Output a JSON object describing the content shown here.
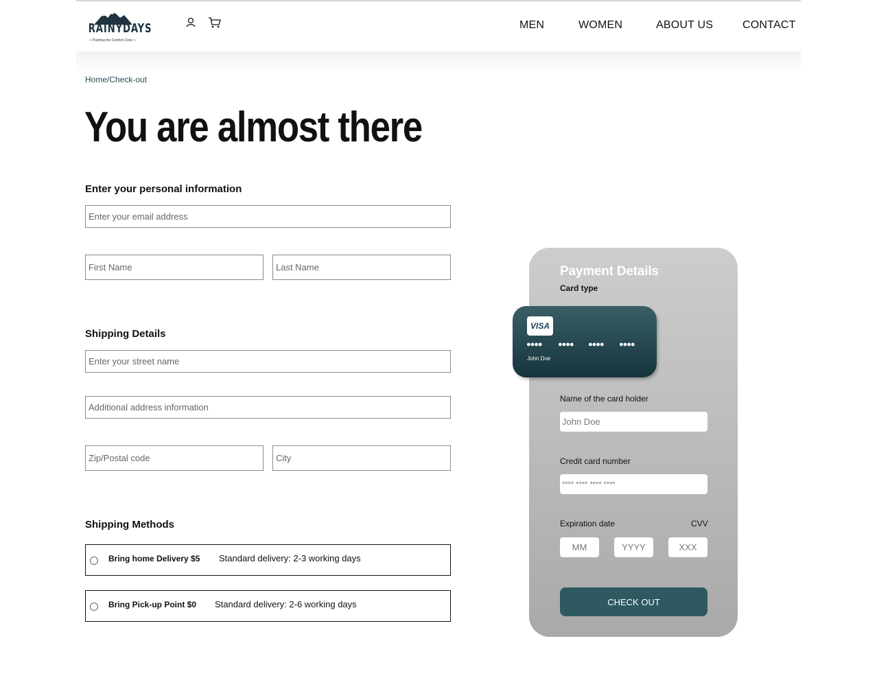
{
  "header": {
    "logo_text": "RAINYDAYS",
    "logo_tagline": "« Pushing the Comfort Zone »",
    "icons": {
      "account": "user-icon",
      "cart": "cart-icon"
    },
    "nav": [
      "MEN",
      "WOMEN",
      "ABOUT US",
      "CONTACT"
    ]
  },
  "breadcrumb": "Home/Check-out",
  "page_title": "You are almost there",
  "personal": {
    "title": "Enter your personal information",
    "email_placeholder": "Enter your email address",
    "first_name_placeholder": "First Name",
    "last_name_placeholder": "Last Name"
  },
  "shipping": {
    "title": "Shipping Details",
    "street_placeholder": "Enter your street name",
    "additional_placeholder": "Additional address information",
    "zip_placeholder": "Zip/Postal code",
    "city_placeholder": "City"
  },
  "methods": {
    "title": "Shipping Methods",
    "options": [
      {
        "name": "Bring home Delivery $5",
        "desc": "Standard delivery: 2-3 working days"
      },
      {
        "name": "Bring Pick-up Point $0",
        "desc": "Standard delivery: 2-6 working days"
      }
    ]
  },
  "payment": {
    "title": "Payment Details",
    "card_type_label": "Card type",
    "card": {
      "brand": "VISA",
      "dots": [
        "●●●●",
        "●●●●",
        "●●●●",
        "●●●●"
      ],
      "holder": "John Doe"
    },
    "holder_label": "Name of the card holder",
    "holder_placeholder": "John Doe",
    "number_label": "Credit card number",
    "number_placeholder": "**** **** **** ****",
    "expiry_label": "Expiration date",
    "cvv_label": "CVV",
    "month_placeholder": "MM",
    "year_placeholder": "YYYY",
    "cvv_placeholder": "XXX",
    "checkout_label": "CHECK OUT"
  },
  "colors": {
    "accent": "#2e5961",
    "card_top": "#3a5e67",
    "card_bottom": "#16343c",
    "panel_top": "#cdcdcd",
    "panel_bottom": "#a9a9a9"
  }
}
